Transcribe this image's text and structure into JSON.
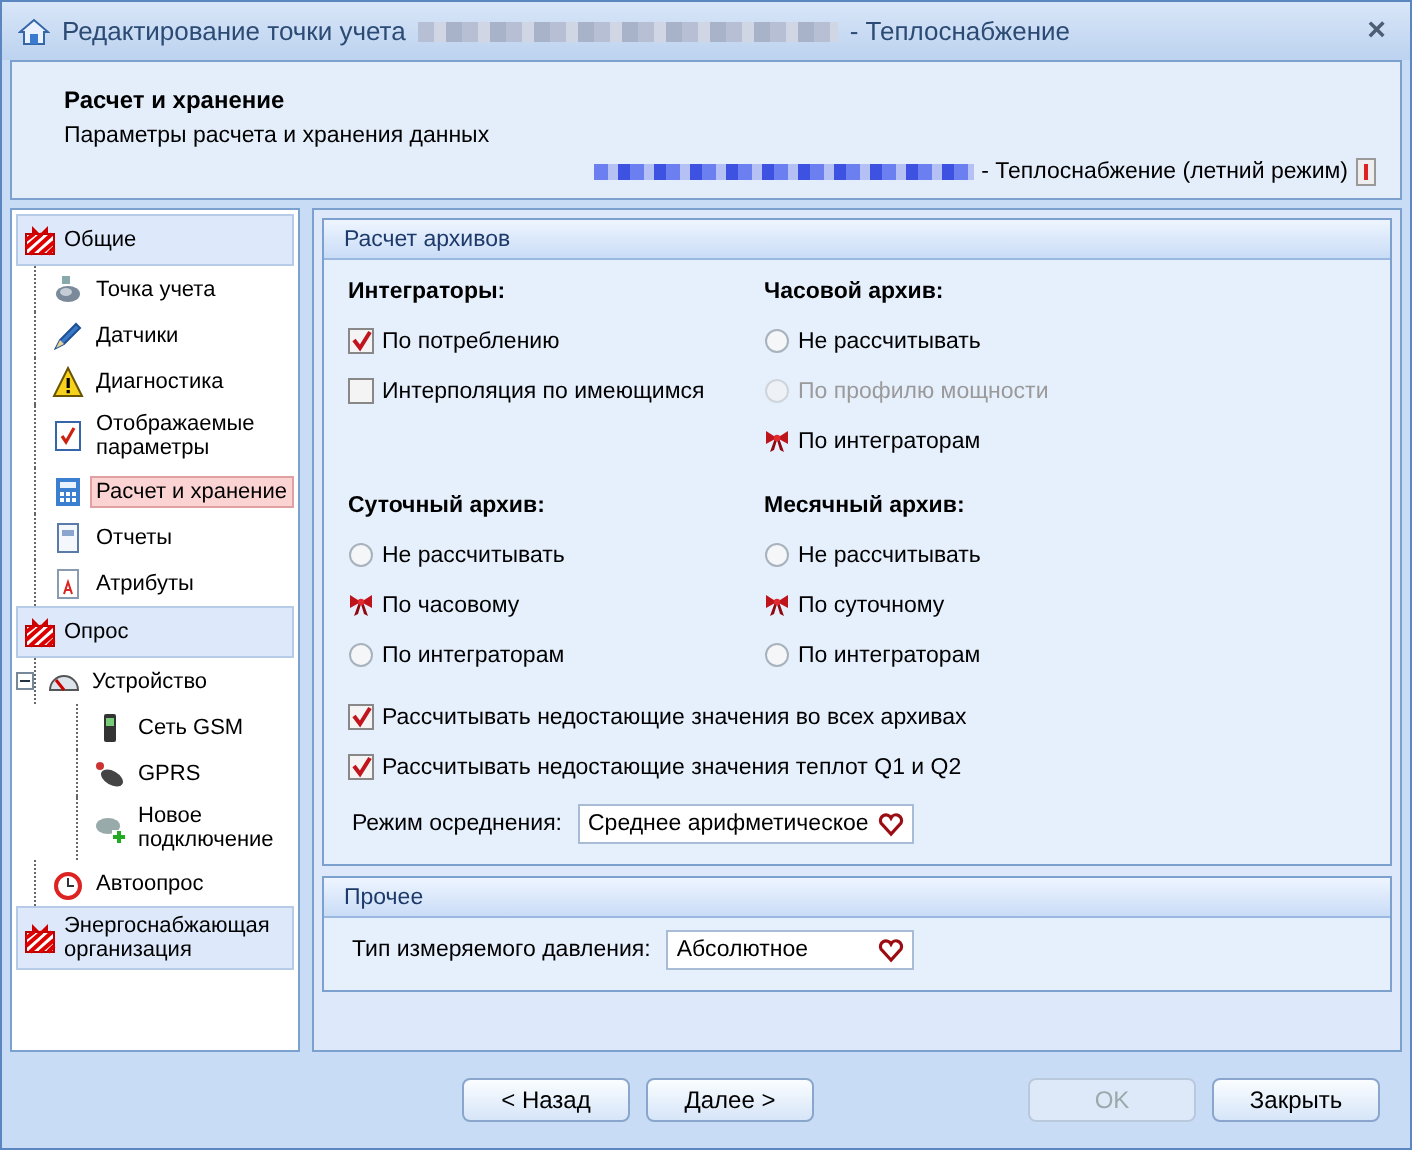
{
  "window": {
    "title": "Редактирование точки учета",
    "title_suffix": "- Теплоснабжение",
    "close": "×"
  },
  "header": {
    "title": "Расчет и хранение",
    "subtitle": "Параметры расчета и хранения данных",
    "mode": "- Теплоснабжение (летний режим)"
  },
  "sidebar": {
    "groups": [
      {
        "label": "Общие",
        "items": [
          {
            "label": "Точка учета",
            "selected": false
          },
          {
            "label": "Датчики",
            "selected": false
          },
          {
            "label": "Диагностика",
            "selected": false
          },
          {
            "label": "Отображаемые параметры",
            "selected": false
          },
          {
            "label": "Расчет и хранение",
            "selected": true
          },
          {
            "label": "Отчеты",
            "selected": false
          },
          {
            "label": "Атрибуты",
            "selected": false
          }
        ]
      },
      {
        "label": "Опрос",
        "items": [
          {
            "label": "Устройство",
            "selected": false,
            "expanded": true,
            "children": [
              {
                "label": "Сеть GSM",
                "selected": false
              },
              {
                "label": "GPRS",
                "selected": false
              },
              {
                "label": "Новое подключение",
                "selected": false
              }
            ]
          },
          {
            "label": "Автоопрос",
            "selected": false
          }
        ]
      },
      {
        "label": "Энергоснабжающая организация"
      }
    ]
  },
  "archives_panel": {
    "title": "Расчет архивов",
    "groups": [
      {
        "title": "Интеграторы:",
        "kind": "checkbox",
        "options": [
          {
            "label": "По потреблению",
            "checked": true
          },
          {
            "label": "Интерполяция по имеющимся",
            "checked": false
          }
        ]
      },
      {
        "title": "Часовой архив:",
        "kind": "radio",
        "options": [
          {
            "label": "Не рассчитывать",
            "selected": false,
            "disabled": false
          },
          {
            "label": "По профилю мощности",
            "selected": false,
            "disabled": true
          },
          {
            "label": "По интеграторам",
            "selected": true,
            "disabled": false
          }
        ]
      },
      {
        "title": "Суточный архив:",
        "kind": "radio",
        "options": [
          {
            "label": "Не рассчитывать",
            "selected": false,
            "disabled": false
          },
          {
            "label": "По часовому",
            "selected": true,
            "disabled": false
          },
          {
            "label": "По интеграторам",
            "selected": false,
            "disabled": false
          }
        ]
      },
      {
        "title": "Месячный архив:",
        "kind": "radio",
        "options": [
          {
            "label": "Не рассчитывать",
            "selected": false,
            "disabled": false
          },
          {
            "label": "По суточному",
            "selected": true,
            "disabled": false
          },
          {
            "label": "По интеграторам",
            "selected": false,
            "disabled": false
          }
        ]
      }
    ],
    "checks": [
      {
        "label": "Рассчитывать недостающие значения во всех архивах",
        "checked": true
      },
      {
        "label": "Рассчитывать недостающие значения теплот Q1 и Q2",
        "checked": true
      }
    ],
    "averaging": {
      "label": "Режим осреднения:",
      "value": "Среднее арифметическое"
    }
  },
  "other_panel": {
    "title": "Прочее",
    "pressure": {
      "label": "Тип измеряемого давления:",
      "value": "Абсолютное"
    }
  },
  "buttons": [
    {
      "label": "< Назад",
      "disabled": false
    },
    {
      "label": "Далее >",
      "disabled": false
    },
    {
      "label": "OK",
      "disabled": true
    },
    {
      "label": "Закрыть",
      "disabled": false
    }
  ]
}
